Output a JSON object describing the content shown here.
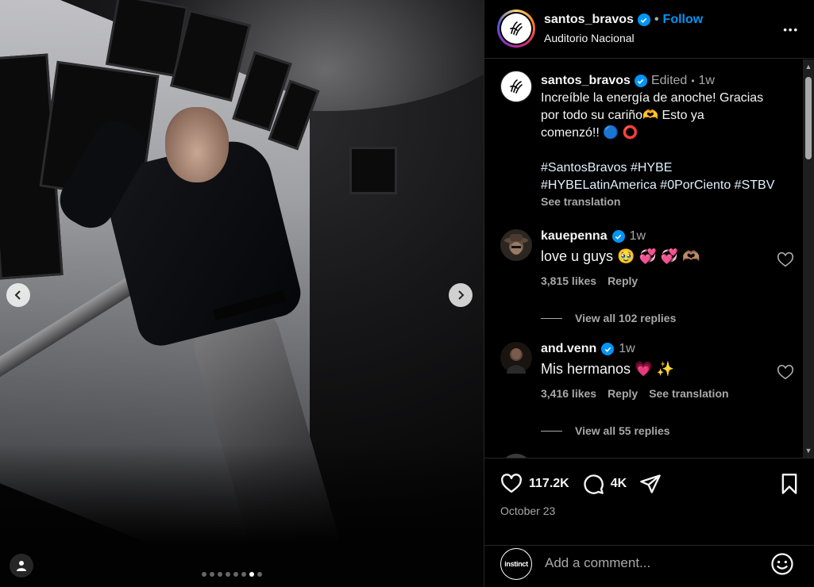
{
  "post": {
    "image_count": 8,
    "active_index": 6
  },
  "header": {
    "username": "santos_bravos",
    "separator": "•",
    "follow_label": "Follow",
    "location": "Auditorio Nacional",
    "more_label": "•••"
  },
  "caption": {
    "username": "santos_bravos",
    "edited": "Edited",
    "separator": "•",
    "time": "1w",
    "text_line1": "Increíble la energía de anoche! Gracias",
    "text_line2": "por todo su cariño🫶 Esto ya",
    "text_line3": "comenzó!! 🔵 ⭕",
    "hashtags_line1": "#SantosBravos #HYBE",
    "hashtags_line2": "#HYBELatinAmerica #0PorCiento #STBV",
    "see_translation": "See translation"
  },
  "comments": [
    {
      "username": "kauepenna",
      "time": "1w",
      "text": "love u guys 🥹 💞 💞 🫶🏽",
      "likes": "3,815 likes",
      "reply_label": "Reply",
      "view_replies": "View all 102 replies"
    },
    {
      "username": "and.venn",
      "time": "1w",
      "text": "Mis hermanos 💗 ✨",
      "likes": "3,416 likes",
      "reply_label": "Reply",
      "translation_label": "See translation",
      "view_replies": "View all 55 replies"
    }
  ],
  "actions": {
    "like_count": "117.2K",
    "comment_count": "4K",
    "date": "October 23"
  },
  "add_comment": {
    "placeholder": "Add a comment...",
    "avatar_text": "instinct"
  },
  "colors": {
    "accent": "#0095f6",
    "background": "#000000",
    "muted": "#a8a8a8",
    "hashtag": "#e0f1ff"
  }
}
